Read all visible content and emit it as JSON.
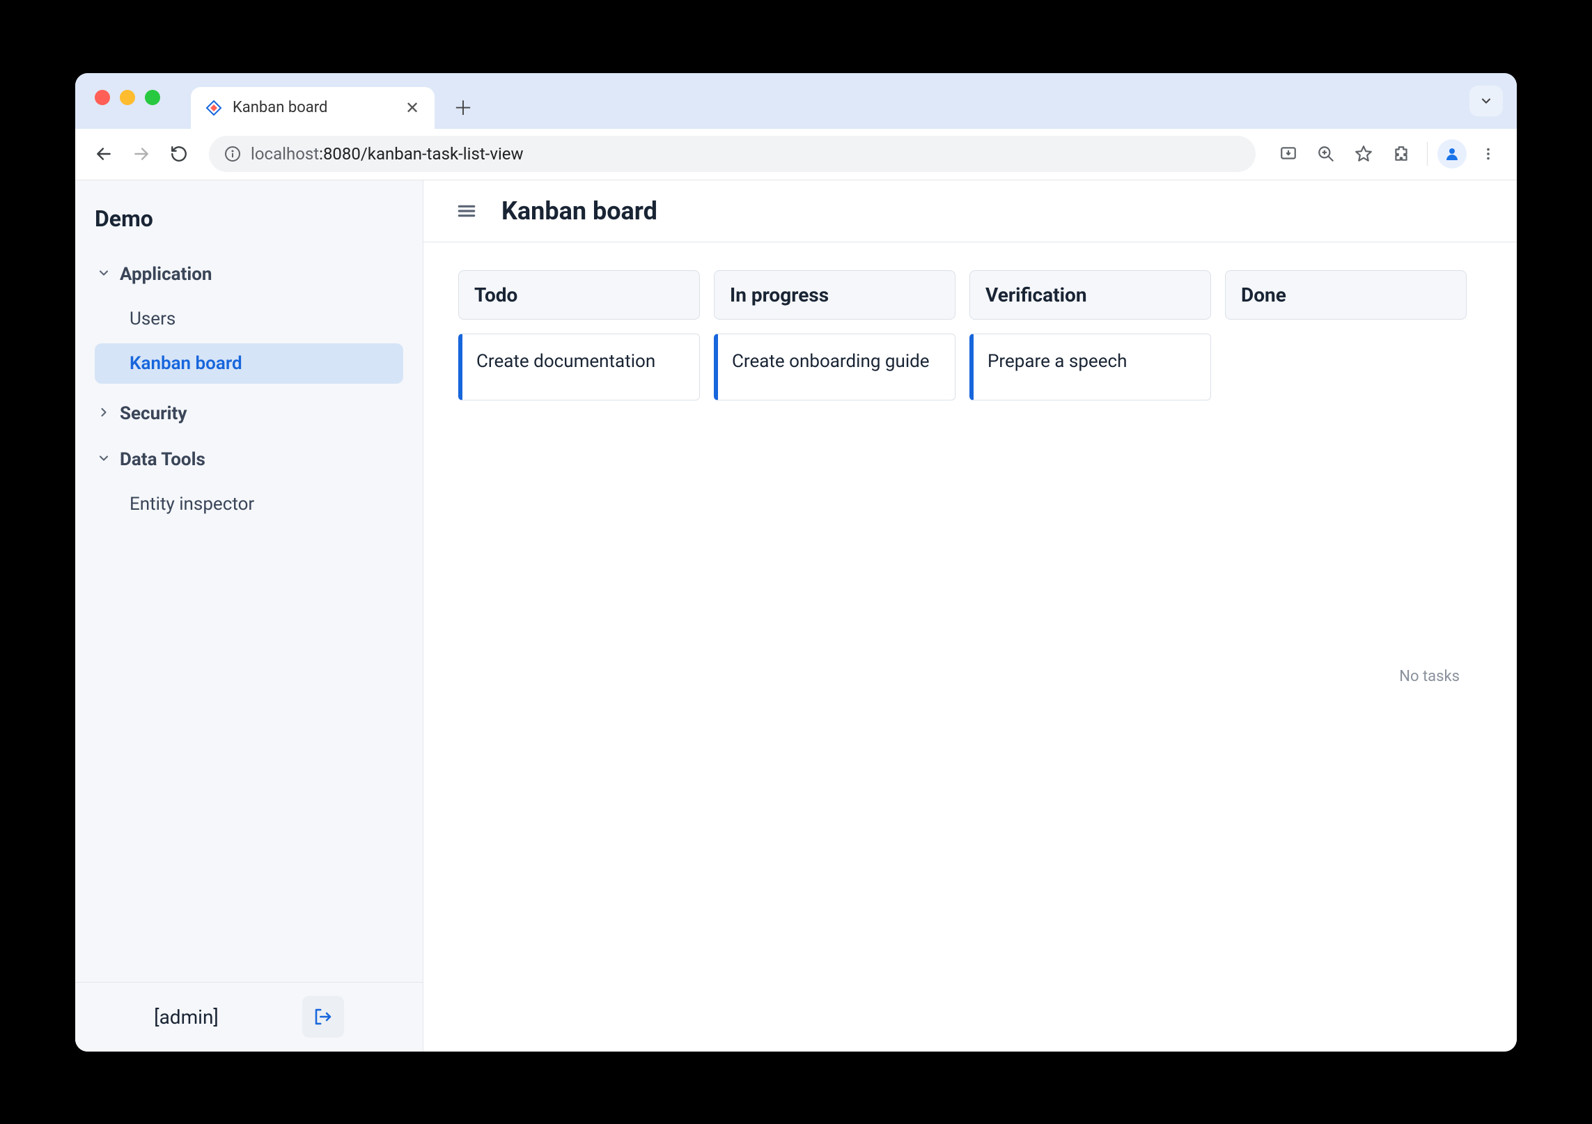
{
  "browser": {
    "tab_title": "Kanban board",
    "url_host": "localhost",
    "url_port_path": ":8080/kanban-task-list-view"
  },
  "sidebar": {
    "app_name": "Demo",
    "groups": [
      {
        "label": "Application",
        "expanded": true,
        "items": [
          {
            "label": "Users",
            "active": false
          },
          {
            "label": "Kanban board",
            "active": true
          }
        ]
      },
      {
        "label": "Security",
        "expanded": false,
        "items": []
      },
      {
        "label": "Data Tools",
        "expanded": true,
        "items": [
          {
            "label": "Entity inspector",
            "active": false
          }
        ]
      }
    ],
    "user": "[admin]"
  },
  "page": {
    "title": "Kanban board"
  },
  "board": {
    "columns": [
      {
        "title": "Todo",
        "cards": [
          "Create documentation"
        ]
      },
      {
        "title": "In progress",
        "cards": [
          "Create onboarding guide"
        ]
      },
      {
        "title": "Verification",
        "cards": [
          "Prepare a speech"
        ]
      },
      {
        "title": "Done",
        "cards": [],
        "empty_text": "No tasks"
      }
    ]
  }
}
